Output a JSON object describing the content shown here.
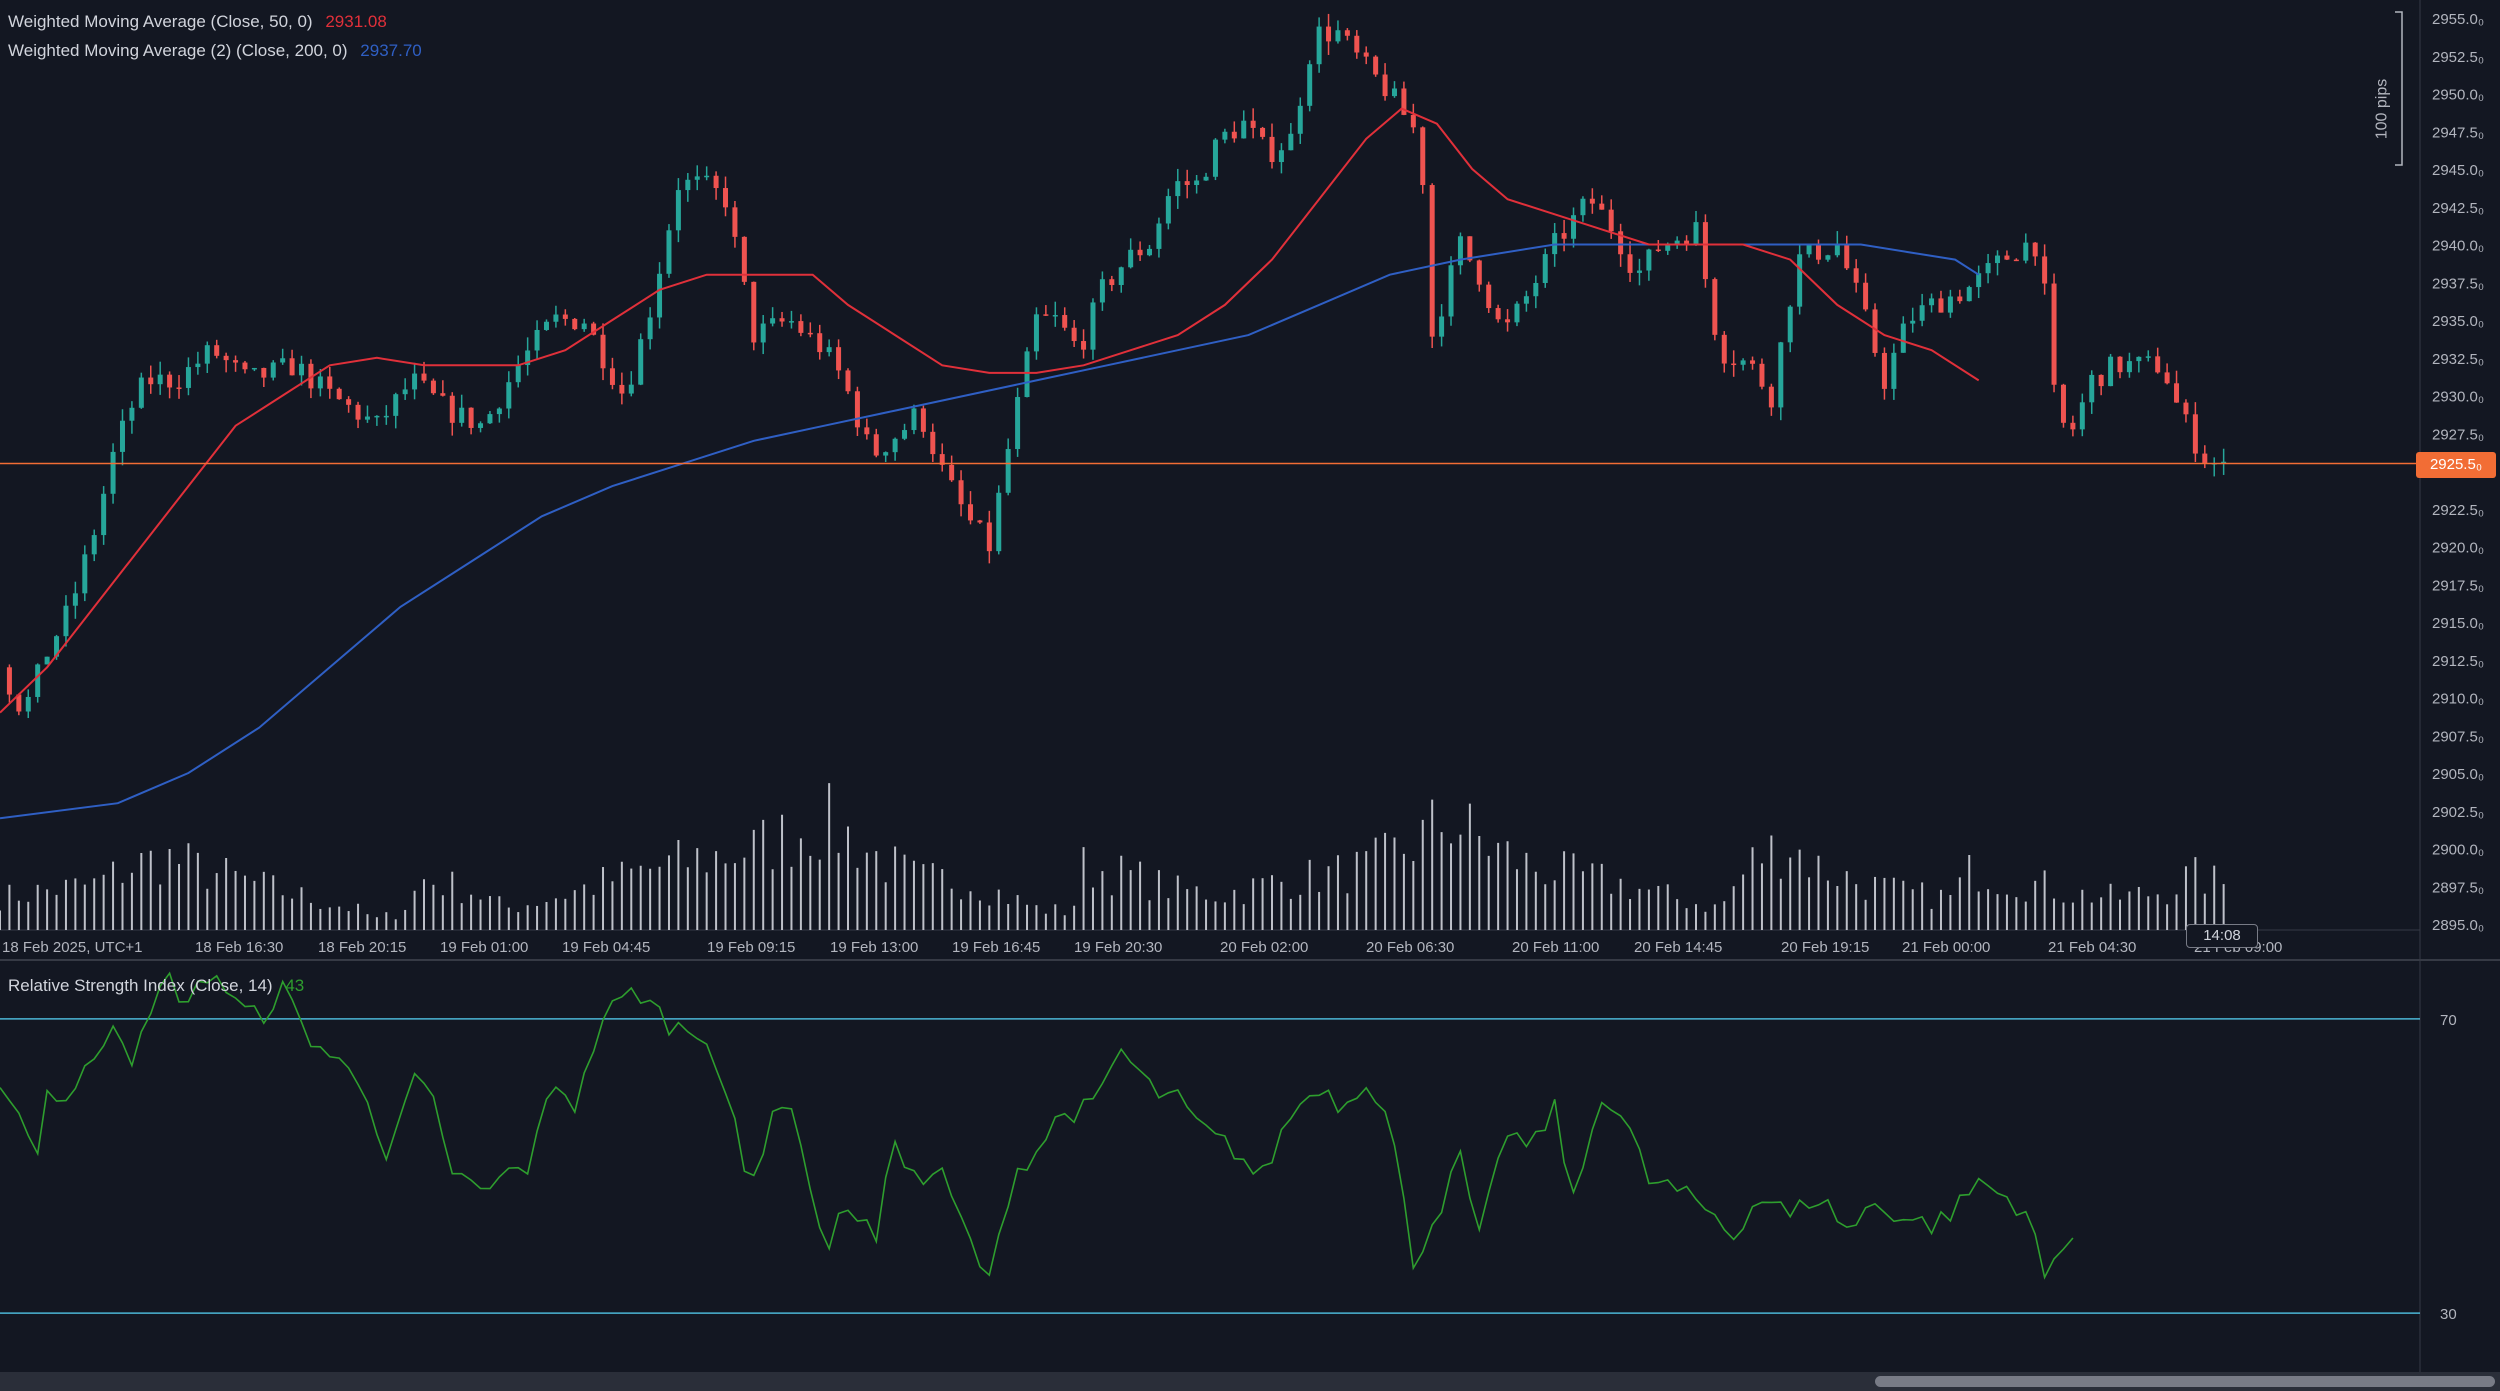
{
  "legend": {
    "wma50_label": "Weighted Moving Average (Close, 50, 0)",
    "wma50_value": "2931.08",
    "wma200_label": "Weighted Moving Average (2) (Close, 200, 0)",
    "wma200_value": "2937.70",
    "rsi_label": "Relative Strength Index (Close, 14)",
    "rsi_value": "43"
  },
  "colors": {
    "background": "#131722",
    "candle_up": "#26a69a",
    "candle_down": "#ef5350",
    "wma50": "#e0303a",
    "wma200": "#2f5fc4",
    "volume": "#d1d4dc",
    "rsi_line": "#2e9e2e",
    "rsi_bands": "#4bb6d6",
    "price_line": "#f26d35"
  },
  "price_axis": {
    "ticks": [
      "2955.0₀",
      "2952.5₀",
      "2950.0₀",
      "2947.5₀",
      "2945.0₀",
      "2942.5₀",
      "2940.0₀",
      "2937.5₀",
      "2935.0₀",
      "2932.5₀",
      "2930.0₀",
      "2927.5₀",
      "2925.5₀",
      "2922.5₀",
      "2920.0₀",
      "2917.5₀",
      "2915.0₀",
      "2912.5₀",
      "2910.0₀",
      "2907.5₀",
      "2905.0₀",
      "2902.5₀",
      "2900.0₀",
      "2897.5₀",
      "2895.0₀"
    ],
    "current_price": "2925.5₀",
    "pips_label": "100 pips"
  },
  "time_axis": {
    "ticks": [
      "18 Feb 2025, UTC+1",
      "18 Feb 16:30",
      "18 Feb 20:15",
      "19 Feb 01:00",
      "19 Feb 04:45",
      "19 Feb 09:15",
      "19 Feb 13:00",
      "19 Feb 16:45",
      "19 Feb 20:30",
      "20 Feb 02:00",
      "20 Feb 06:30",
      "20 Feb 11:00",
      "20 Feb 14:45",
      "20 Feb 19:15",
      "21 Feb 00:00",
      "21 Feb 04:30",
      "21 Feb 09:00"
    ],
    "countdown": "14:08"
  },
  "rsi_axis": {
    "ticks": [
      "70",
      "30"
    ]
  },
  "chart_data": [
    {
      "type": "candlestick",
      "series_names": [
        "Weighted Moving Average (Close, 50, 0)",
        "Weighted Moving Average (2) (Close, 200, 0)"
      ],
      "ylim": [
        2895.0,
        2955.0
      ],
      "current_price": 2925.5,
      "close_path": [
        [
          0,
          2912
        ],
        [
          10,
          2909
        ],
        [
          20,
          2913
        ],
        [
          30,
          2916
        ],
        [
          40,
          2921
        ],
        [
          48,
          2926
        ],
        [
          55,
          2929
        ],
        [
          62,
          2931
        ],
        [
          75,
          2931
        ],
        [
          90,
          2933
        ],
        [
          105,
          2931
        ],
        [
          125,
          2932
        ],
        [
          140,
          2930
        ],
        [
          160,
          2928
        ],
        [
          175,
          2931
        ],
        [
          190,
          2929
        ],
        [
          205,
          2928
        ],
        [
          220,
          2932
        ],
        [
          235,
          2935
        ],
        [
          248,
          2935
        ],
        [
          258,
          2932
        ],
        [
          265,
          2930
        ],
        [
          275,
          2935
        ],
        [
          288,
          2944
        ],
        [
          298,
          2944
        ],
        [
          308,
          2943
        ],
        [
          320,
          2934
        ],
        [
          335,
          2935
        ],
        [
          350,
          2933
        ],
        [
          358,
          2931
        ],
        [
          370,
          2926
        ],
        [
          385,
          2928
        ],
        [
          390,
          2929
        ],
        [
          400,
          2925
        ],
        [
          410,
          2922
        ],
        [
          420,
          2920
        ],
        [
          430,
          2928
        ],
        [
          440,
          2935
        ],
        [
          448,
          2935
        ],
        [
          458,
          2933
        ],
        [
          468,
          2937
        ],
        [
          478,
          2939
        ],
        [
          488,
          2940
        ],
        [
          498,
          2944
        ],
        [
          508,
          2944
        ],
        [
          518,
          2947
        ],
        [
          528,
          2948
        ],
        [
          538,
          2946
        ],
        [
          548,
          2947
        ],
        [
          558,
          2954
        ],
        [
          568,
          2954
        ],
        [
          578,
          2952
        ],
        [
          590,
          2950
        ],
        [
          603,
          2947
        ],
        [
          608,
          2934
        ],
        [
          620,
          2940
        ],
        [
          628,
          2938
        ],
        [
          638,
          2934
        ],
        [
          650,
          2937
        ],
        [
          660,
          2940
        ],
        [
          675,
          2943
        ],
        [
          685,
          2941
        ],
        [
          695,
          2938
        ],
        [
          705,
          2940
        ],
        [
          720,
          2941
        ],
        [
          730,
          2933
        ],
        [
          743,
          2932
        ],
        [
          752,
          2930
        ],
        [
          763,
          2939
        ],
        [
          780,
          2940
        ],
        [
          790,
          2936
        ],
        [
          800,
          2931
        ],
        [
          810,
          2935
        ],
        [
          820,
          2936
        ],
        [
          835,
          2937
        ],
        [
          850,
          2939
        ],
        [
          860,
          2940
        ],
        [
          866,
          2940
        ],
        [
          872,
          2930
        ],
        [
          878,
          2927
        ],
        [
          888,
          2931
        ],
        [
          898,
          2932
        ],
        [
          918,
          2932
        ],
        [
          925,
          2929
        ],
        [
          935,
          2926
        ],
        [
          945,
          2925
        ]
      ],
      "volume_range": [
        0,
        100
      ],
      "volume_path": [
        [
          0,
          18
        ],
        [
          20,
          22
        ],
        [
          40,
          25
        ],
        [
          55,
          35
        ],
        [
          70,
          40
        ],
        [
          90,
          32
        ],
        [
          110,
          25
        ],
        [
          130,
          18
        ],
        [
          150,
          12
        ],
        [
          160,
          6
        ],
        [
          170,
          10
        ],
        [
          180,
          28
        ],
        [
          200,
          22
        ],
        [
          215,
          12
        ],
        [
          240,
          20
        ],
        [
          260,
          28
        ],
        [
          280,
          35
        ],
        [
          300,
          40
        ],
        [
          320,
          45
        ],
        [
          340,
          55
        ],
        [
          350,
          60
        ],
        [
          360,
          52
        ],
        [
          375,
          38
        ],
        [
          390,
          28
        ],
        [
          410,
          28
        ],
        [
          425,
          20
        ],
        [
          440,
          12
        ],
        [
          455,
          10
        ],
        [
          460,
          35
        ],
        [
          480,
          30
        ],
        [
          500,
          22
        ],
        [
          520,
          20
        ],
        [
          540,
          26
        ],
        [
          560,
          30
        ],
        [
          580,
          34
        ],
        [
          600,
          48
        ],
        [
          615,
          62
        ],
        [
          630,
          48
        ],
        [
          650,
          35
        ],
        [
          670,
          30
        ],
        [
          690,
          25
        ],
        [
          710,
          18
        ],
        [
          730,
          12
        ],
        [
          745,
          40
        ],
        [
          760,
          48
        ],
        [
          770,
          36
        ],
        [
          790,
          26
        ],
        [
          810,
          20
        ],
        [
          828,
          18
        ],
        [
          838,
          35
        ],
        [
          848,
          30
        ],
        [
          860,
          26
        ],
        [
          870,
          24
        ],
        [
          880,
          20
        ],
        [
          900,
          18
        ],
        [
          920,
          22
        ],
        [
          930,
          30
        ],
        [
          945,
          25
        ]
      ],
      "wma50_path": [
        [
          0,
          2909
        ],
        [
          20,
          2912
        ],
        [
          40,
          2916
        ],
        [
          60,
          2920
        ],
        [
          80,
          2924
        ],
        [
          100,
          2928
        ],
        [
          120,
          2930
        ],
        [
          140,
          2932
        ],
        [
          160,
          2932.5
        ],
        [
          180,
          2932
        ],
        [
          200,
          2932
        ],
        [
          220,
          2932
        ],
        [
          240,
          2933
        ],
        [
          260,
          2935
        ],
        [
          280,
          2937
        ],
        [
          300,
          2938
        ],
        [
          320,
          2938
        ],
        [
          345,
          2938
        ],
        [
          360,
          2936
        ],
        [
          380,
          2934
        ],
        [
          400,
          2932
        ],
        [
          420,
          2931.5
        ],
        [
          440,
          2931.5
        ],
        [
          460,
          2932
        ],
        [
          480,
          2933
        ],
        [
          500,
          2934
        ],
        [
          520,
          2936
        ],
        [
          540,
          2939
        ],
        [
          560,
          2943
        ],
        [
          580,
          2947
        ],
        [
          595,
          2949
        ],
        [
          610,
          2948
        ],
        [
          625,
          2945
        ],
        [
          640,
          2943
        ],
        [
          660,
          2942
        ],
        [
          680,
          2941
        ],
        [
          700,
          2940
        ],
        [
          720,
          2940
        ],
        [
          740,
          2940
        ],
        [
          760,
          2939
        ],
        [
          780,
          2936
        ],
        [
          800,
          2934
        ],
        [
          820,
          2933
        ],
        [
          840,
          2931
        ]
      ],
      "wma200_path": [
        [
          0,
          2902
        ],
        [
          50,
          2903
        ],
        [
          80,
          2905
        ],
        [
          110,
          2908
        ],
        [
          140,
          2912
        ],
        [
          170,
          2916
        ],
        [
          200,
          2919
        ],
        [
          230,
          2922
        ],
        [
          260,
          2924
        ],
        [
          290,
          2925.5
        ],
        [
          320,
          2927
        ],
        [
          350,
          2928
        ],
        [
          380,
          2929
        ],
        [
          410,
          2930
        ],
        [
          440,
          2931
        ],
        [
          470,
          2932
        ],
        [
          500,
          2933
        ],
        [
          530,
          2934
        ],
        [
          560,
          2936
        ],
        [
          590,
          2938
        ],
        [
          620,
          2939
        ],
        [
          660,
          2940
        ],
        [
          700,
          2940
        ],
        [
          740,
          2940
        ],
        [
          770,
          2940
        ],
        [
          790,
          2940
        ],
        [
          810,
          2939.5
        ],
        [
          830,
          2939
        ],
        [
          840,
          2938
        ]
      ]
    },
    {
      "type": "line",
      "series_names": [
        "Relative Strength Index (Close, 14)"
      ],
      "ylim": [
        22,
        78
      ],
      "bands": [
        30,
        70
      ],
      "current_value": 43,
      "rsi_path": [
        [
          0,
          62
        ],
        [
          10,
          56
        ],
        [
          15,
          51
        ],
        [
          20,
          60
        ],
        [
          30,
          59
        ],
        [
          40,
          65
        ],
        [
          48,
          70
        ],
        [
          56,
          65
        ],
        [
          62,
          68
        ],
        [
          70,
          76
        ],
        [
          80,
          72
        ],
        [
          90,
          77
        ],
        [
          100,
          72
        ],
        [
          110,
          70
        ],
        [
          120,
          74
        ],
        [
          130,
          68
        ],
        [
          140,
          65
        ],
        [
          155,
          61
        ],
        [
          165,
          50
        ],
        [
          175,
          62
        ],
        [
          185,
          58
        ],
        [
          190,
          50
        ],
        [
          205,
          46
        ],
        [
          215,
          49
        ],
        [
          225,
          50
        ],
        [
          235,
          62
        ],
        [
          245,
          58
        ],
        [
          255,
          70
        ],
        [
          270,
          74
        ],
        [
          285,
          69
        ],
        [
          300,
          68
        ],
        [
          310,
          58
        ],
        [
          318,
          46
        ],
        [
          330,
          60
        ],
        [
          340,
          54
        ],
        [
          350,
          38
        ],
        [
          360,
          45
        ],
        [
          372,
          40
        ],
        [
          380,
          54
        ],
        [
          390,
          47
        ],
        [
          398,
          50
        ],
        [
          410,
          41
        ],
        [
          420,
          34
        ],
        [
          430,
          49
        ],
        [
          440,
          52
        ],
        [
          450,
          57
        ],
        [
          465,
          58
        ],
        [
          475,
          66
        ],
        [
          490,
          60
        ],
        [
          500,
          59
        ],
        [
          510,
          55
        ],
        [
          525,
          52
        ],
        [
          535,
          48
        ],
        [
          548,
          57
        ],
        [
          560,
          61
        ],
        [
          570,
          58
        ],
        [
          580,
          62
        ],
        [
          590,
          56
        ],
        [
          600,
          37
        ],
        [
          612,
          45
        ],
        [
          620,
          51
        ],
        [
          628,
          40
        ],
        [
          640,
          55
        ],
        [
          650,
          52
        ],
        [
          660,
          58
        ],
        [
          668,
          45
        ],
        [
          680,
          60
        ],
        [
          690,
          56
        ],
        [
          700,
          48
        ],
        [
          710,
          47
        ],
        [
          720,
          45
        ],
        [
          730,
          43
        ],
        [
          735,
          40
        ],
        [
          742,
          44
        ],
        [
          750,
          46
        ],
        [
          760,
          43
        ],
        [
          770,
          46
        ],
        [
          778,
          44
        ],
        [
          785,
          41
        ],
        [
          795,
          45
        ],
        [
          808,
          43
        ],
        [
          820,
          42
        ],
        [
          830,
          44
        ],
        [
          840,
          48
        ],
        [
          850,
          46
        ],
        [
          860,
          44
        ],
        [
          868,
          35
        ],
        [
          875,
          38
        ],
        [
          882,
          43
        ]
      ]
    }
  ]
}
